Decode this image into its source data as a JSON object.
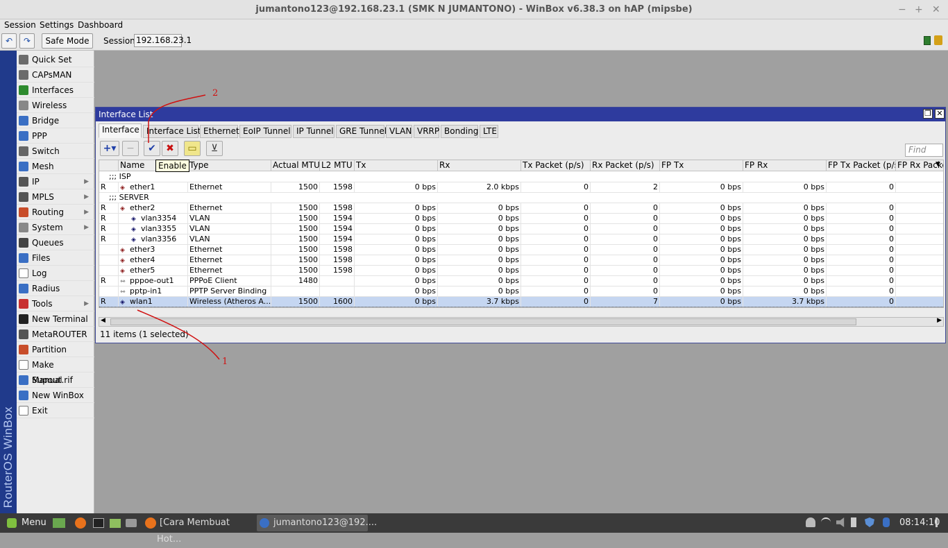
{
  "window": {
    "title": "jumantono123@192.168.23.1 (SMK N JUMANTONO) - WinBox v6.38.3 on hAP (mipsbe)",
    "minimize": "−",
    "maximize": "+",
    "close": "✕"
  },
  "menubar": {
    "session": "Session",
    "settings": "Settings",
    "dashboard": "Dashboard"
  },
  "toolbar": {
    "undo_icon": "↶",
    "redo_icon": "↷",
    "safe_mode": "Safe Mode",
    "session_label": "Session:",
    "session_value": "192.168.23.1"
  },
  "brand": "RouterOS WinBox",
  "sidebar": {
    "items": [
      {
        "label": "Quick Set",
        "icon": "quickset-icon",
        "color": "#6b6b6b"
      },
      {
        "label": "CAPsMAN",
        "icon": "capsman-icon",
        "color": "#6b6b6b"
      },
      {
        "label": "Interfaces",
        "icon": "interfaces-icon",
        "color": "#2e8b2e"
      },
      {
        "label": "Wireless",
        "icon": "wireless-icon",
        "color": "#888888"
      },
      {
        "label": "Bridge",
        "icon": "bridge-icon",
        "color": "#3a6fc4"
      },
      {
        "label": "PPP",
        "icon": "ppp-icon",
        "color": "#3a6fc4"
      },
      {
        "label": "Switch",
        "icon": "switch-icon",
        "color": "#666666"
      },
      {
        "label": "Mesh",
        "icon": "mesh-icon",
        "color": "#3a6fc4"
      },
      {
        "label": "IP",
        "icon": "ip-icon",
        "color": "#555555",
        "arrow": "▶"
      },
      {
        "label": "MPLS",
        "icon": "mpls-icon",
        "color": "#555555",
        "arrow": "▶"
      },
      {
        "label": "Routing",
        "icon": "routing-icon",
        "color": "#c84d2a",
        "arrow": "▶"
      },
      {
        "label": "System",
        "icon": "system-icon",
        "color": "#888888",
        "arrow": "▶"
      },
      {
        "label": "Queues",
        "icon": "queues-icon",
        "color": "#444444"
      },
      {
        "label": "Files",
        "icon": "files-icon",
        "color": "#3a6fc4"
      },
      {
        "label": "Log",
        "icon": "log-icon",
        "color": "#ffffff"
      },
      {
        "label": "Radius",
        "icon": "radius-icon",
        "color": "#3a6fc4"
      },
      {
        "label": "Tools",
        "icon": "tools-icon",
        "color": "#c83030",
        "arrow": "▶"
      },
      {
        "label": "New Terminal",
        "icon": "terminal-icon",
        "color": "#222222"
      },
      {
        "label": "MetaROUTER",
        "icon": "metarouter-icon",
        "color": "#555555"
      },
      {
        "label": "Partition",
        "icon": "partition-icon",
        "color": "#c84d2a"
      },
      {
        "label": "Make Supout.rif",
        "icon": "supout-icon",
        "color": "#ffffff"
      },
      {
        "label": "Manual",
        "icon": "manual-icon",
        "color": "#3a6fc4"
      },
      {
        "label": "New WinBox",
        "icon": "winbox-icon",
        "color": "#3a6fc4"
      },
      {
        "label": "Exit",
        "icon": "exit-icon",
        "color": "#ffffff"
      }
    ]
  },
  "interface_window": {
    "title": "Interface List",
    "restore": "❐",
    "close": "✕",
    "tabs": [
      "Interface",
      "Interface List",
      "Ethernet",
      "EoIP Tunnel",
      "IP Tunnel",
      "GRE Tunnel",
      "VLAN",
      "VRRP",
      "Bonding",
      "LTE"
    ],
    "buttons": {
      "add": "+▾",
      "remove": "−",
      "enable": "✔",
      "disable": "✖",
      "comment": "▭",
      "filter": "⊻"
    },
    "find_placeholder": "Find",
    "tooltip": "Enable",
    "columns": [
      "",
      "Name",
      "Type",
      "Actual MTU",
      "L2 MTU",
      "Tx",
      "Rx",
      "Tx Packet (p/s)",
      "Rx Packet (p/s)",
      "FP Tx",
      "FP Rx",
      "FP Tx Packet (p/s)",
      "FP Rx Packet"
    ],
    "sort_arrow": "▼",
    "rows": [
      {
        "comment": ";;; ISP"
      },
      {
        "flag": "R",
        "icon": "ether",
        "name": "ether1",
        "indent": 0,
        "type": "Ethernet",
        "mtu": "1500",
        "l2mtu": "1598",
        "tx": "0 bps",
        "rx": "2.0 kbps",
        "txp": "0",
        "rxp": "2",
        "fptx": "0 bps",
        "fprx": "0 bps",
        "fptxp": "0"
      },
      {
        "comment": ";;; SERVER"
      },
      {
        "flag": "R",
        "icon": "ether",
        "name": "ether2",
        "indent": 0,
        "type": "Ethernet",
        "mtu": "1500",
        "l2mtu": "1598",
        "tx": "0 bps",
        "rx": "0 bps",
        "txp": "0",
        "rxp": "0",
        "fptx": "0 bps",
        "fprx": "0 bps",
        "fptxp": "0"
      },
      {
        "flag": "R",
        "icon": "vlan",
        "name": "vlan3354",
        "indent": 1,
        "type": "VLAN",
        "mtu": "1500",
        "l2mtu": "1594",
        "tx": "0 bps",
        "rx": "0 bps",
        "txp": "0",
        "rxp": "0",
        "fptx": "0 bps",
        "fprx": "0 bps",
        "fptxp": "0"
      },
      {
        "flag": "R",
        "icon": "vlan",
        "name": "vlan3355",
        "indent": 1,
        "type": "VLAN",
        "mtu": "1500",
        "l2mtu": "1594",
        "tx": "0 bps",
        "rx": "0 bps",
        "txp": "0",
        "rxp": "0",
        "fptx": "0 bps",
        "fprx": "0 bps",
        "fptxp": "0"
      },
      {
        "flag": "R",
        "icon": "vlan",
        "name": "vlan3356",
        "indent": 1,
        "type": "VLAN",
        "mtu": "1500",
        "l2mtu": "1594",
        "tx": "0 bps",
        "rx": "0 bps",
        "txp": "0",
        "rxp": "0",
        "fptx": "0 bps",
        "fprx": "0 bps",
        "fptxp": "0"
      },
      {
        "flag": "",
        "icon": "ether",
        "name": "ether3",
        "indent": 0,
        "type": "Ethernet",
        "mtu": "1500",
        "l2mtu": "1598",
        "tx": "0 bps",
        "rx": "0 bps",
        "txp": "0",
        "rxp": "0",
        "fptx": "0 bps",
        "fprx": "0 bps",
        "fptxp": "0"
      },
      {
        "flag": "",
        "icon": "ether",
        "name": "ether4",
        "indent": 0,
        "type": "Ethernet",
        "mtu": "1500",
        "l2mtu": "1598",
        "tx": "0 bps",
        "rx": "0 bps",
        "txp": "0",
        "rxp": "0",
        "fptx": "0 bps",
        "fprx": "0 bps",
        "fptxp": "0"
      },
      {
        "flag": "",
        "icon": "ether",
        "name": "ether5",
        "indent": 0,
        "type": "Ethernet",
        "mtu": "1500",
        "l2mtu": "1598",
        "tx": "0 bps",
        "rx": "0 bps",
        "txp": "0",
        "rxp": "0",
        "fptx": "0 bps",
        "fprx": "0 bps",
        "fptxp": "0"
      },
      {
        "flag": "R",
        "icon": "ppp",
        "name": "pppoe-out1",
        "indent": 0,
        "type": "PPPoE Client",
        "mtu": "1480",
        "l2mtu": "",
        "tx": "0 bps",
        "rx": "0 bps",
        "txp": "0",
        "rxp": "0",
        "fptx": "0 bps",
        "fprx": "0 bps",
        "fptxp": "0"
      },
      {
        "flag": "",
        "icon": "ppp",
        "name": "pptp-in1",
        "indent": 0,
        "type": "PPTP Server Binding",
        "mtu": "",
        "l2mtu": "",
        "tx": "0 bps",
        "rx": "0 bps",
        "txp": "0",
        "rxp": "0",
        "fptx": "0 bps",
        "fprx": "0 bps",
        "fptxp": "0"
      },
      {
        "flag": "R",
        "icon": "vlan",
        "name": "wlan1",
        "indent": 0,
        "type": "Wireless (Atheros A...",
        "mtu": "1500",
        "l2mtu": "1600",
        "tx": "0 bps",
        "rx": "3.7 kbps",
        "txp": "0",
        "rxp": "7",
        "fptx": "0 bps",
        "fprx": "3.7 kbps",
        "fptxp": "0",
        "selected": true
      }
    ],
    "scroll_left": "◀",
    "scroll_right": "▶",
    "status": "11 items (1 selected)"
  },
  "annotations": {
    "label1": "1",
    "label2": "2",
    "color": "#d01010"
  },
  "taskbar": {
    "menu": "Menu",
    "tasks": [
      "[Cara Membuat Hot...",
      "jumantono123@192...."
    ],
    "clock": "08:14:10"
  }
}
